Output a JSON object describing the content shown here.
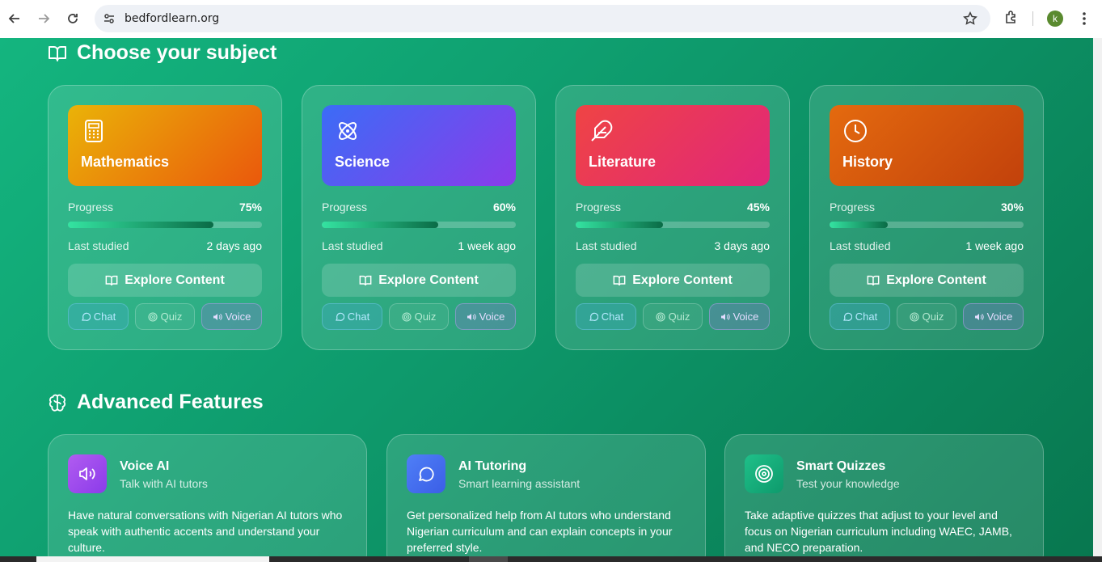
{
  "browser": {
    "url": "bedfordlearn.org",
    "profile_initial": "k"
  },
  "subjects_section": {
    "title": "Choose your subject",
    "icon": "open-book-icon"
  },
  "subjects": [
    {
      "name": "Mathematics",
      "icon": "calculator-icon",
      "gradient": [
        "#eab308",
        "#ea580c"
      ],
      "progress_label": "Progress",
      "progress": "75%",
      "progress_value": 0.75,
      "last_label": "Last studied",
      "last": "2 days ago",
      "explore": "Explore Content",
      "chat": "Chat",
      "quiz": "Quiz",
      "voice": "Voice"
    },
    {
      "name": "Science",
      "icon": "atom-icon",
      "gradient": [
        "#3b6cf6",
        "#8b3bea"
      ],
      "progress_label": "Progress",
      "progress": "60%",
      "progress_value": 0.6,
      "last_label": "Last studied",
      "last": "1 week ago",
      "explore": "Explore Content",
      "chat": "Chat",
      "quiz": "Quiz",
      "voice": "Voice"
    },
    {
      "name": "Literature",
      "icon": "feather-icon",
      "gradient": [
        "#ef4444",
        "#e1267a"
      ],
      "progress_label": "Progress",
      "progress": "45%",
      "progress_value": 0.45,
      "last_label": "Last studied",
      "last": "3 days ago",
      "explore": "Explore Content",
      "chat": "Chat",
      "quiz": "Quiz",
      "voice": "Voice"
    },
    {
      "name": "History",
      "icon": "clock-icon",
      "gradient": [
        "#e46a0e",
        "#c2410c"
      ],
      "progress_label": "Progress",
      "progress": "30%",
      "progress_value": 0.3,
      "last_label": "Last studied",
      "last": "1 week ago",
      "explore": "Explore Content",
      "chat": "Chat",
      "quiz": "Quiz",
      "voice": "Voice"
    }
  ],
  "features_section": {
    "title": "Advanced Features",
    "icon": "brain-icon"
  },
  "features": [
    {
      "title": "Voice AI",
      "subtitle": "Talk with AI tutors",
      "icon": "speaker-icon",
      "color": [
        "#b15cf0",
        "#8b3bea"
      ],
      "description": "Have natural conversations with Nigerian AI tutors who speak with authentic accents and understand your culture."
    },
    {
      "title": "AI Tutoring",
      "subtitle": "Smart learning assistant",
      "icon": "chat-bubble-icon",
      "color": [
        "#4f7ff7",
        "#3b5ee6"
      ],
      "description": "Get personalized help from AI tutors who understand Nigerian curriculum and can explain concepts in your preferred style."
    },
    {
      "title": "Smart Quizzes",
      "subtitle": "Test your knowledge",
      "icon": "target-icon",
      "color": [
        "#1fc089",
        "#0e9a6c"
      ],
      "description": "Take adaptive quizzes that adjust to your level and focus on Nigerian curriculum including WAEC, JAMB, and NECO preparation."
    }
  ]
}
